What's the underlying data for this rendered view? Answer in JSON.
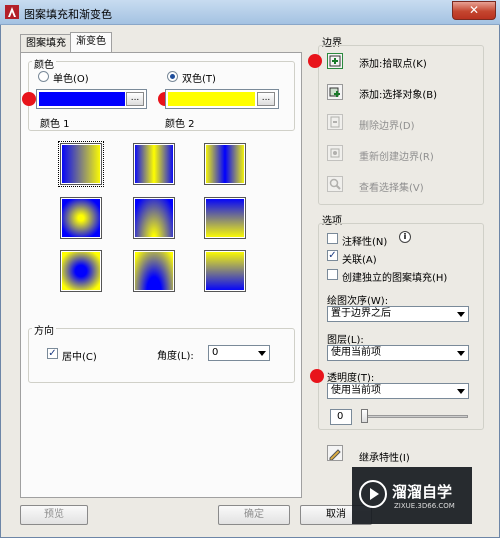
{
  "window": {
    "title": "图案填充和渐变色",
    "close_symbol": "✕"
  },
  "tabs": [
    {
      "label": "图案填充"
    },
    {
      "label": "渐变色"
    }
  ],
  "color_group": {
    "title": "颜色",
    "single_label": "单色(O)",
    "double_label": "双色(T)",
    "color1_label": "颜色 1",
    "color2_label": "颜色 2",
    "color1": "#0000ff",
    "color2": "#ffff00",
    "browse_label": "..."
  },
  "patterns": [
    "linear-h",
    "linear-h-sym",
    "linear-h-inv",
    "spherical",
    "hemispherical",
    "curved",
    "spherical-inv",
    "hemispherical-inv",
    "curved-inv"
  ],
  "orientation": {
    "title": "方向",
    "centered_label": "居中(C)",
    "centered": true,
    "angle_label": "角度(L):",
    "angle_value": "0"
  },
  "boundaries": {
    "title": "边界",
    "items": [
      {
        "label": "添加:拾取点(K)",
        "icon": "pick-point-icon",
        "enabled": true
      },
      {
        "label": "添加:选择对象(B)",
        "icon": "select-objects-icon",
        "enabled": true
      },
      {
        "label": "删除边界(D)",
        "icon": "remove-boundary-icon",
        "enabled": false
      },
      {
        "label": "重新创建边界(R)",
        "icon": "recreate-boundary-icon",
        "enabled": false
      },
      {
        "label": "查看选择集(V)",
        "icon": "view-selection-icon",
        "enabled": false
      }
    ]
  },
  "options": {
    "title": "选项",
    "annotative_label": "注释性(N)",
    "annotative": false,
    "info_symbol": "i",
    "associative_label": "关联(A)",
    "associative": true,
    "separate_label": "创建独立的图案填充(H)",
    "separate": false,
    "draw_order_label": "绘图次序(W):",
    "draw_order_value": "置于边界之后",
    "layer_label": "图层(L):",
    "layer_value": "使用当前项",
    "transparency_label": "透明度(T):",
    "transparency_value": "使用当前项",
    "transparency_number": "0",
    "slider_level": 0
  },
  "inherit_label": "继承特性(I)",
  "buttons": {
    "preview": "预览",
    "ok": "确定",
    "cancel": "取消"
  },
  "watermark": {
    "brand": "溜溜自学",
    "url": "ZIXUE.3D66.COM"
  },
  "checkmark": "✓"
}
